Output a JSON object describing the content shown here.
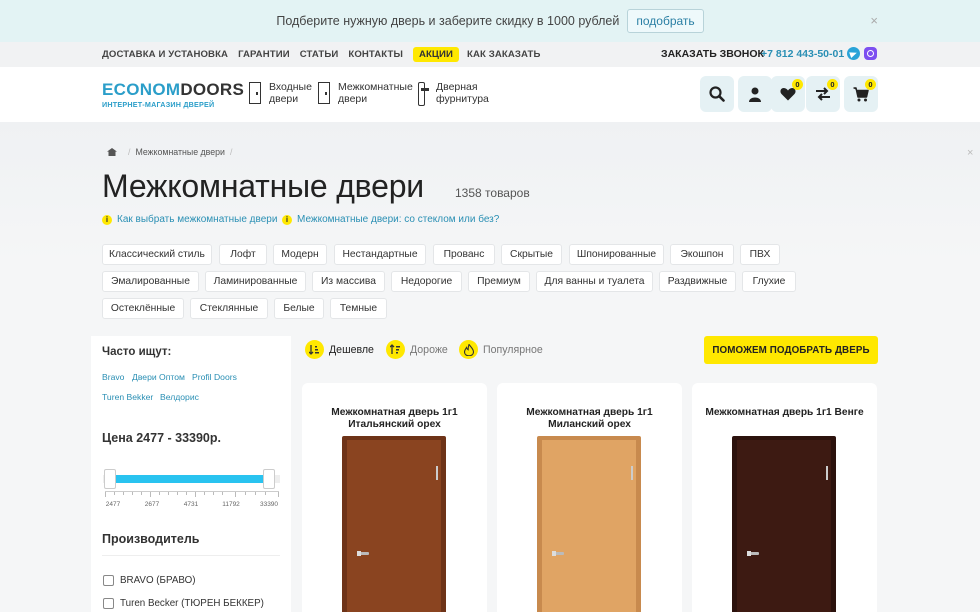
{
  "promo": {
    "text": "Подберите нужную дверь и заберите скидку в 1000 рублей",
    "button": "подобрать",
    "close": "×"
  },
  "topnav": {
    "links": [
      "ДОСТАВКА И УСТАНОВКА",
      "ГАРАНТИИ",
      "СТАТЬИ",
      "КОНТАКТЫ",
      "АКЦИИ",
      "КАК ЗАКАЗАТЬ"
    ],
    "callback": "ЗАКАЗАТЬ ЗВОНОК",
    "phone": "+7 812 443-50-01"
  },
  "header": {
    "logo_part1": "ECONOM",
    "logo_part2": "DOORS",
    "logo_sub": "ИНТЕРНЕТ-МАГАЗИН ДВЕРЕЙ",
    "categories": [
      {
        "line1": "Входные",
        "line2": "двери"
      },
      {
        "line1": "Межкомнатные",
        "line2": "двери"
      },
      {
        "line1": "Дверная",
        "line2": "фурнитура"
      }
    ],
    "badges": {
      "favorites": "0",
      "compare": "0",
      "cart": "0"
    }
  },
  "breadcrumb": {
    "current": "Межкомнатные двери",
    "sep": "/"
  },
  "page": {
    "close": "×",
    "title": "Межкомнатные двери",
    "count": "1358 товаров",
    "info_links": [
      "Как выбрать межкомнатные двери",
      "Межкомнатные двери: со стеклом или без?"
    ],
    "info_icon": "i"
  },
  "tags": [
    "Классический стиль",
    "Лофт",
    "Модерн",
    "Нестандартные",
    "Прованс",
    "Скрытые",
    "Шпонированные",
    "Экошпон",
    "ПВХ",
    "Эмалированные",
    "Ламинированные",
    "Из массива",
    "Недорогие",
    "Премиум",
    "Для ванны и туалета",
    "Раздвижные",
    "Глухие",
    "Остеклённые",
    "Стеклянные",
    "Белые",
    "Темные"
  ],
  "sidebar": {
    "often_title": "Часто ищут:",
    "often_links": [
      "Bravo",
      "Двери Оптом",
      "Profil Doors",
      "Turen Bekker",
      "Велдорис"
    ],
    "price_title": "Цена  2477 - 33390р.",
    "scale_labels": [
      "2477",
      "2677",
      "4731",
      "11792",
      "33390"
    ],
    "manufacturer_title": "Производитель",
    "manufacturers": [
      "BRAVO (БРАВО)",
      "Turen Becker (ТЮРЕН БЕККЕР)"
    ]
  },
  "sorting": {
    "options": [
      "Дешевле",
      "Дороже",
      "Популярное"
    ],
    "help_button": "ПОМОЖЕМ ПОДОБРАТЬ ДВЕРЬ"
  },
  "products": [
    {
      "title": "Межкомнатная дверь 1г1 Итальянский орех",
      "frame_color": "#6e3318",
      "panel_color": "#8a4420"
    },
    {
      "title": "Межкомнатная дверь 1г1 Миланский орех",
      "frame_color": "#c88a4e",
      "panel_color": "#e0a464"
    },
    {
      "title": "Межкомнатная дверь 1г1 Венге",
      "frame_color": "#2c120d",
      "panel_color": "#3d1a12"
    }
  ]
}
